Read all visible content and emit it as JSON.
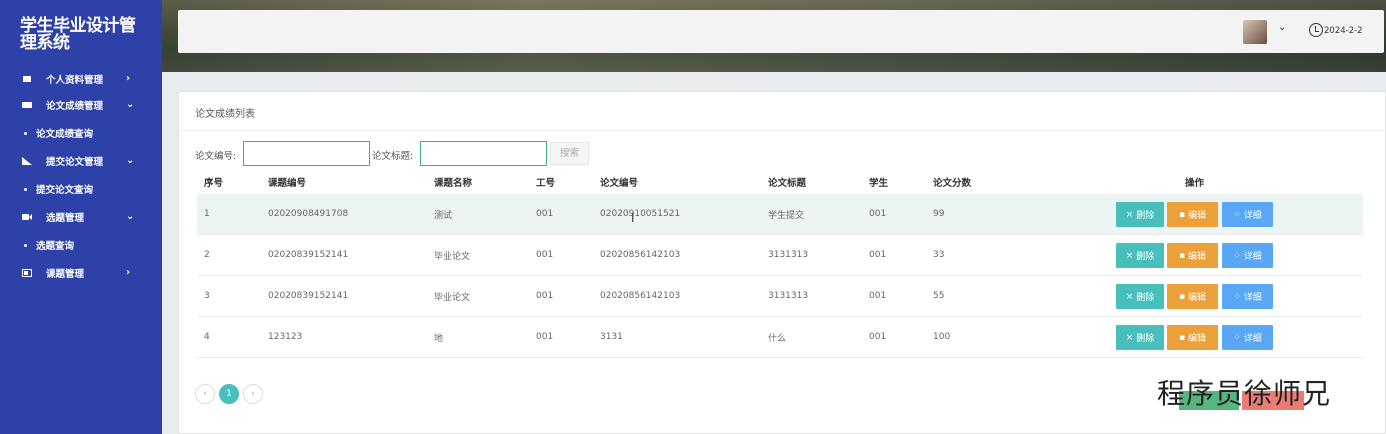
{
  "sidebar": {
    "title": "学生毕业设计管理系统",
    "menu": [
      {
        "label": "个人资料管理",
        "icon": "profile-icon"
      },
      {
        "label": "论文成绩管理",
        "icon": "grade-icon",
        "sub": "论文成绩查询"
      },
      {
        "label": "提交论文管理",
        "icon": "submit-icon",
        "sub": "提交论文查询"
      },
      {
        "label": "选题管理",
        "icon": "topic-icon",
        "sub": "选题查询"
      },
      {
        "label": "课题管理",
        "icon": "project-icon"
      }
    ]
  },
  "header": {
    "date": "2024-2-2"
  },
  "panel": {
    "title": "论文成绩列表",
    "search": {
      "paper_no_label": "论文编号:",
      "paper_no_value": "",
      "paper_title_label": "论文标题:",
      "paper_title_value": "",
      "search_button": "搜索"
    },
    "columns": [
      "序号",
      "课题编号",
      "课题名称",
      "工号",
      "论文编号",
      "论文标题",
      "学生",
      "论文分数",
      "操作"
    ],
    "rows": [
      [
        "1",
        "02020908491708",
        "测试",
        "001",
        "02020910051521",
        "学生提交",
        "001",
        "99"
      ],
      [
        "2",
        "02020839152141",
        "毕业论文",
        "001",
        "02020856142103",
        "3131313",
        "001",
        "33"
      ],
      [
        "3",
        "02020839152141",
        "毕业论文",
        "001",
        "02020856142103",
        "3131313",
        "001",
        "55"
      ],
      [
        "4",
        "123123",
        "地",
        "001",
        "3131",
        "什么",
        "001",
        "100"
      ]
    ],
    "actions": {
      "delete": "删除",
      "edit": "编辑",
      "detail": "详细"
    },
    "pager": {
      "prev": "‹",
      "current": "1",
      "next": "›"
    }
  },
  "watermark": "程序员徐师兄",
  "colors": {
    "sidebar": "#2d41a8",
    "delete": "#49bfbd",
    "edit": "#eba03a",
    "detail": "#5aa7f5",
    "input_border": "#3bb18a"
  }
}
